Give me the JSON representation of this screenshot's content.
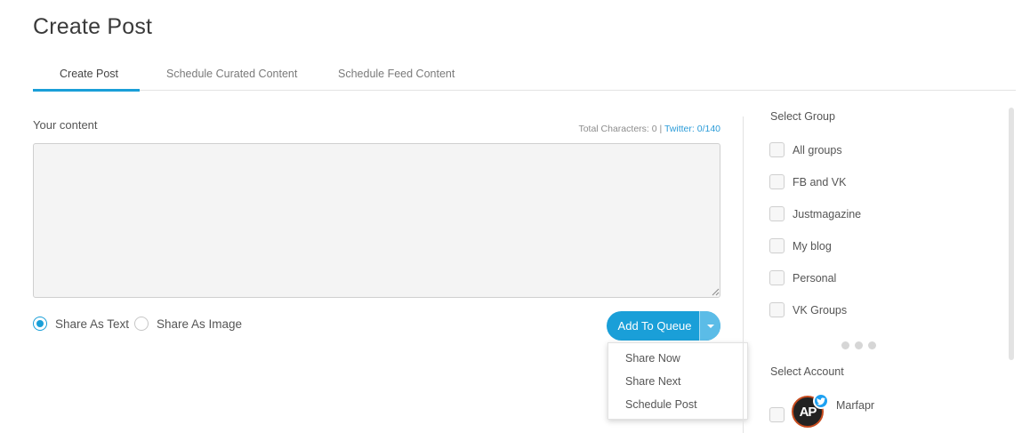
{
  "page": {
    "title": "Create Post"
  },
  "tabs": [
    {
      "label": "Create Post",
      "active": true
    },
    {
      "label": "Schedule Curated Content",
      "active": false
    },
    {
      "label": "Schedule Feed Content",
      "active": false
    }
  ],
  "composer": {
    "label": "Your content",
    "content": "",
    "counter": {
      "total_label": "Total Characters: 0 |",
      "twitter_label": "Twitter: 0/140"
    }
  },
  "share_mode": {
    "options": [
      {
        "label": "Share As Text",
        "checked": true
      },
      {
        "label": "Share As Image",
        "checked": false
      }
    ]
  },
  "queue_button": {
    "label": "Add To Queue",
    "menu": [
      "Share Now",
      "Share Next",
      "Schedule Post"
    ]
  },
  "groups": {
    "heading": "Select Group",
    "items": [
      {
        "label": "All groups",
        "checked": false
      },
      {
        "label": "FB and VK",
        "checked": false
      },
      {
        "label": "Justmagazine",
        "checked": false
      },
      {
        "label": "My blog",
        "checked": false
      },
      {
        "label": "Personal",
        "checked": false
      },
      {
        "label": "VK Groups",
        "checked": false
      }
    ]
  },
  "accounts": {
    "heading": "Select Account",
    "items": [
      {
        "name": "Marfapr",
        "avatar_text": "AP",
        "network_icon": "twitter-icon",
        "checked": false
      }
    ]
  },
  "colors": {
    "accent": "#1a9fd8",
    "twitter": "#1da1f2"
  }
}
